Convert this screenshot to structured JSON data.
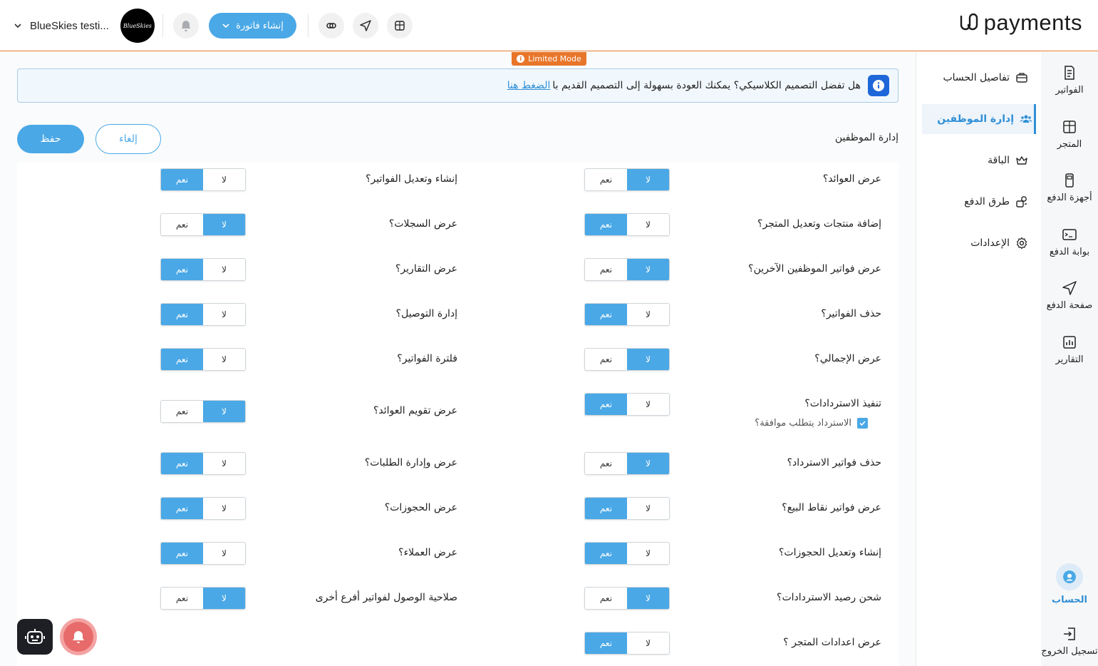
{
  "header": {
    "logo_text": "payments",
    "account_name": "BlueSkies testi...",
    "account_avatar_text": "BlueSkies",
    "create_invoice_label": "إنشاء فاتورة"
  },
  "limited_mode_label": "Limited Mode",
  "rail": {
    "items": [
      {
        "label": "الفواتير",
        "icon": "invoice-icon"
      },
      {
        "label": "المتجر",
        "icon": "store-icon"
      },
      {
        "label": "أجهزة الدفع",
        "icon": "pos-device-icon"
      },
      {
        "label": "بوابة الدفع",
        "icon": "gateway-icon"
      },
      {
        "label": "صفحة الدفع",
        "icon": "send-icon"
      },
      {
        "label": "التقارير",
        "icon": "chart-icon"
      }
    ],
    "account_label": "الحساب",
    "logout_label": "تسجيل الخروج"
  },
  "submenu": {
    "items": [
      {
        "label": "تفاصيل الحساب",
        "icon": "briefcase-icon"
      },
      {
        "label": "إدارة الموظفين",
        "icon": "users-icon"
      },
      {
        "label": "الباقة",
        "icon": "crown-icon"
      },
      {
        "label": "طرق الدفع",
        "icon": "payment-methods-icon"
      },
      {
        "label": "الإعدادات",
        "icon": "gear-icon"
      }
    ]
  },
  "banner": {
    "text": "هل تفضل التصميم الكلاسيكي؟ يمكنك العودة بسهولة إلى التصميم القديم با",
    "link": "الضغط هنا"
  },
  "section_title": "إدارة الموظفين",
  "actions": {
    "save": "حفظ",
    "cancel": "إلغاء"
  },
  "toggle_labels": {
    "no": "لا",
    "yes": "نعم"
  },
  "permissions_right": [
    {
      "label": "عرض العوائد؟",
      "value": "لا"
    },
    {
      "label": "إضافة منتجات وتعديل المتجر؟",
      "value": "نعم"
    },
    {
      "label": "عرض فواتير الموظفين الآخرين؟",
      "value": "لا"
    },
    {
      "label": "حذف الفواتير؟",
      "value": "نعم"
    },
    {
      "label": "عرض الإجمالي؟",
      "value": "لا"
    },
    {
      "label": "تنفيذ الاستردادات؟",
      "value": "نعم"
    },
    {
      "label": "حذف فواتير الاسترداد؟",
      "value": "لا"
    },
    {
      "label": "عرض فواتير نقاط البيع؟",
      "value": "نعم"
    },
    {
      "label": "إنشاء وتعديل الحجوزات؟",
      "value": "نعم"
    },
    {
      "label": "شحن رصيد الاستردادات؟",
      "value": "لا"
    },
    {
      "label": "عرض اعدادات المتجر ؟",
      "value": "نعم"
    }
  ],
  "refund_approval_label": "الاسترداد يتطلب موافقة؟",
  "permissions_left": [
    {
      "label": "إنشاء وتعديل الفواتير؟",
      "value": "نعم"
    },
    {
      "label": "عرض السجلات؟",
      "value": "لا"
    },
    {
      "label": "عرض التقارير؟",
      "value": "نعم"
    },
    {
      "label": "إدارة التوصيل؟",
      "value": "نعم"
    },
    {
      "label": "فلترة الفواتير؟",
      "value": "نعم"
    },
    {
      "label": "عرض تقويم العوائد؟",
      "value": "لا"
    },
    {
      "label": "عرض وإدارة الطلبات؟",
      "value": "نعم"
    },
    {
      "label": "عرض الحجوزات؟",
      "value": "نعم"
    },
    {
      "label": "عرض العملاء؟",
      "value": "نعم"
    },
    {
      "label": "صلاحية الوصول لفواتير أفرع أخرى",
      "value": "لا"
    }
  ],
  "colors": {
    "accent": "#4aa8e6",
    "orange": "#e8762a",
    "info": "#1e67d9"
  }
}
